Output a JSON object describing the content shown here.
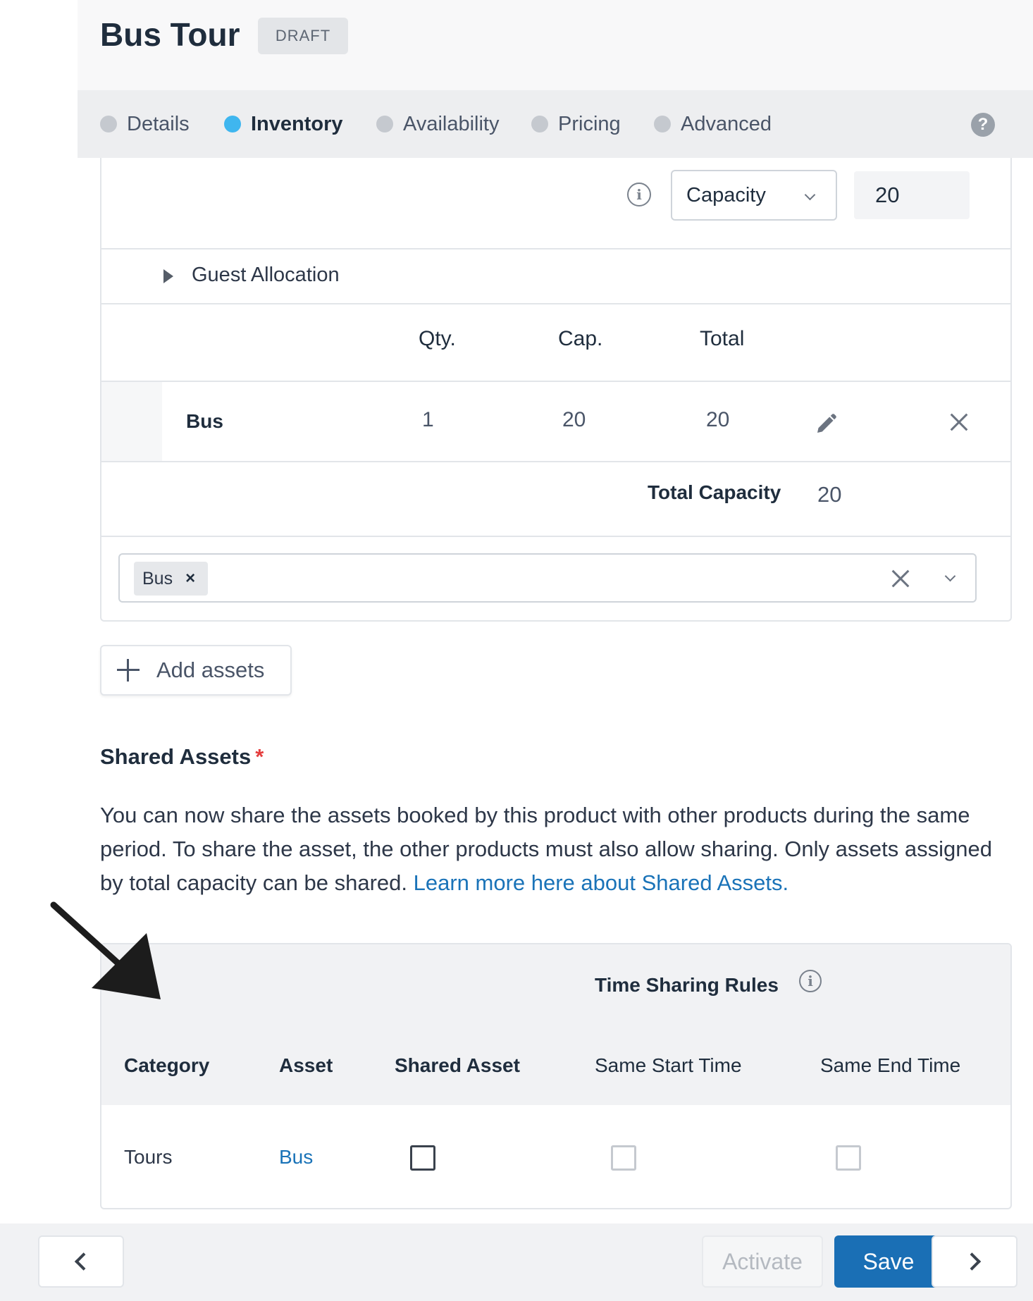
{
  "header": {
    "title": "Bus Tour",
    "status_badge": "DRAFT"
  },
  "tabs": [
    {
      "label": "Details",
      "active": false
    },
    {
      "label": "Inventory",
      "active": true
    },
    {
      "label": "Availability",
      "active": false
    },
    {
      "label": "Pricing",
      "active": false
    },
    {
      "label": "Advanced",
      "active": false
    }
  ],
  "help_icon_glyph": "?",
  "inventory": {
    "info_glyph": "i",
    "mode_select": {
      "value": "Capacity"
    },
    "capacity_value": "20",
    "guest_allocation_label": "Guest Allocation",
    "table": {
      "headers": [
        "Qty.",
        "Cap.",
        "Total"
      ],
      "rows": [
        {
          "name": "Bus",
          "qty": "1",
          "cap": "20",
          "total": "20"
        }
      ]
    },
    "total_capacity_label": "Total Capacity",
    "total_capacity_value": "20",
    "selected_assets": [
      {
        "label": "Bus",
        "remove_glyph": "×"
      }
    ],
    "add_assets_label": "Add assets"
  },
  "shared_assets": {
    "title": "Shared Assets",
    "required_mark": "*",
    "description": "You can now share the assets booked by this product with other products during the same period. To share the asset, the other products must also allow sharing. Only assets assigned by total capacity can be shared.",
    "learn_more_link": "Learn more here about Shared Assets.",
    "time_sharing_rules_label": "Time Sharing Rules",
    "columns": [
      "Category",
      "Asset",
      "Shared Asset",
      "Same Start Time",
      "Same End Time"
    ],
    "rows": [
      {
        "category": "Tours",
        "asset": "Bus",
        "shared": false,
        "same_start": false,
        "same_end": false
      }
    ]
  },
  "footer": {
    "activate_label": "Activate",
    "save_label": "Save"
  },
  "colors": {
    "accent": "#1a6fb5",
    "active_tab_dot": "#3fb6ef",
    "link": "#1a73b8",
    "required": "#e53e3e"
  }
}
